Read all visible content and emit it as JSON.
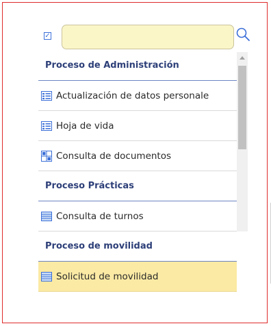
{
  "search": {
    "value": "",
    "placeholder": ""
  },
  "icons": {
    "checkbox": "checkbox-checked-icon",
    "search": "search-icon",
    "list": "list-icon",
    "grid": "grid-icon",
    "table": "table-icon"
  },
  "colors": {
    "frame_border": "#e02a2a",
    "header_text": "#2d3f78",
    "selected_bg": "#fbeaa4",
    "search_bg": "#fbf6c8",
    "icon_blue": "#3b6fd8"
  },
  "menu": {
    "groups": [
      {
        "header": "Proceso de Administración",
        "items": [
          {
            "label": "Actualización de datos personale",
            "icon": "list-icon"
          },
          {
            "label": "Hoja de vida",
            "icon": "list-icon"
          },
          {
            "label": "Consulta de documentos",
            "icon": "grid-icon"
          }
        ]
      },
      {
        "header": "Proceso Prácticas",
        "items": [
          {
            "label": "Consulta de turnos",
            "icon": "table-icon"
          }
        ]
      },
      {
        "header": "Proceso de movilidad",
        "items": [
          {
            "label": "Solicitud de movilidad",
            "icon": "table-icon",
            "selected": true
          }
        ]
      }
    ]
  }
}
